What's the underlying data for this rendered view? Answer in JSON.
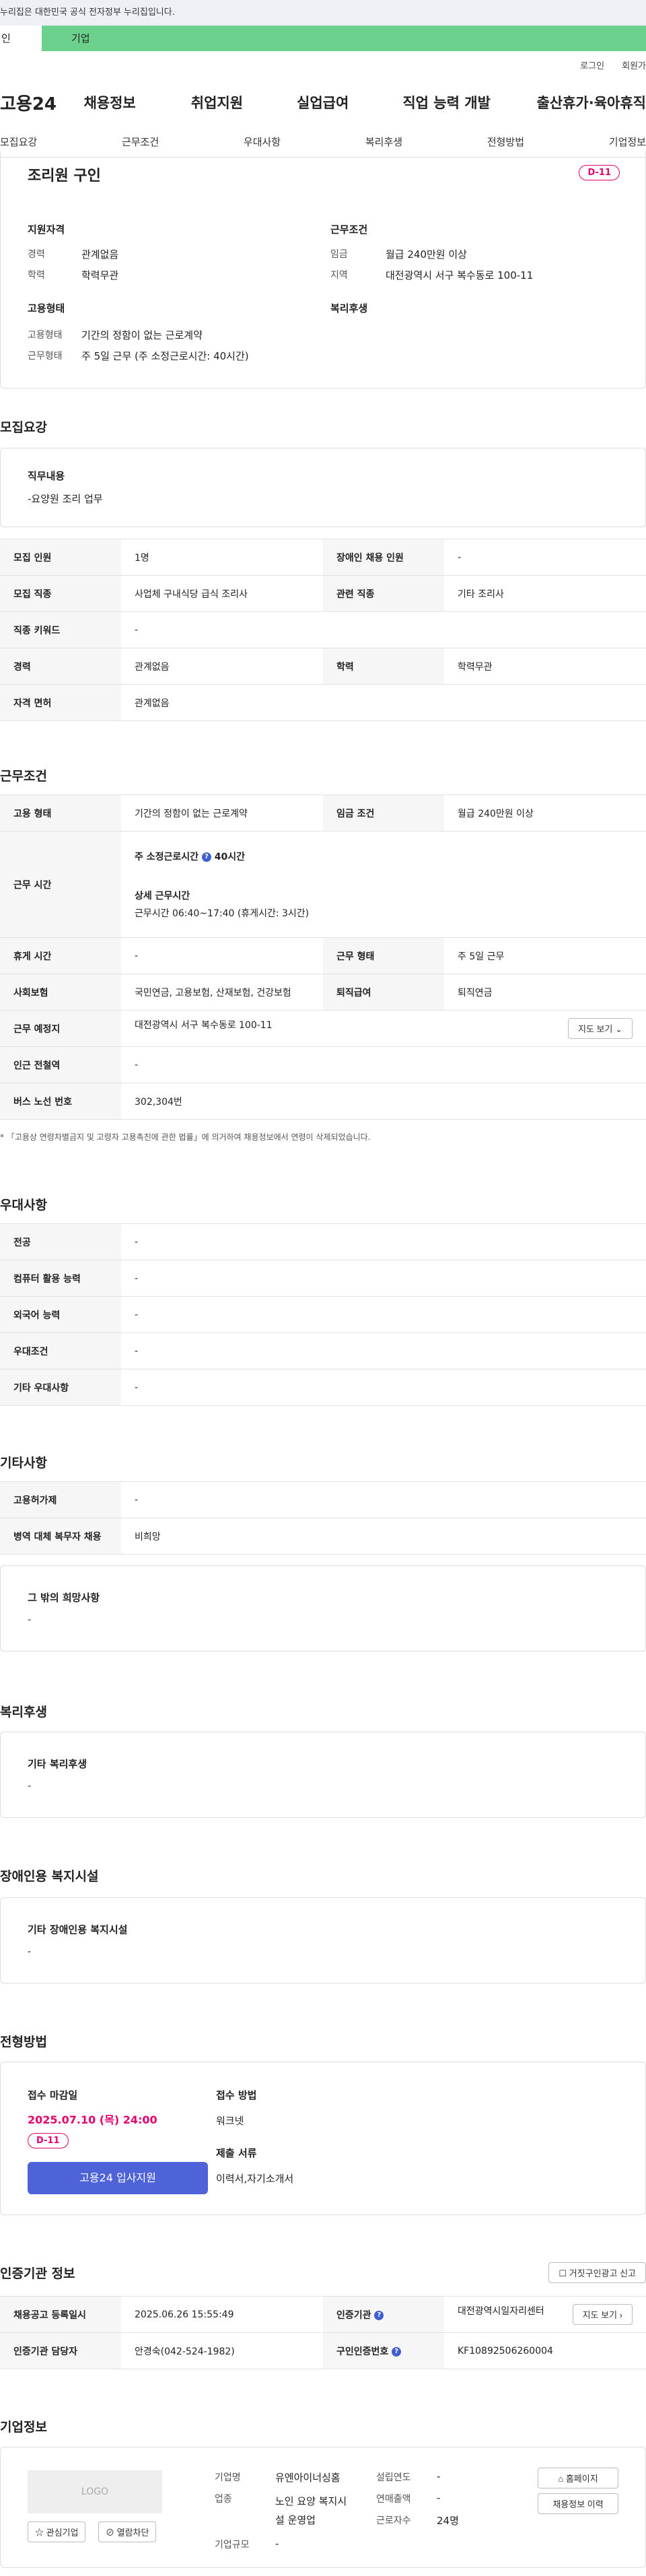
{
  "gov_bar": "누리집은 대한민국 공식 전자정부 누리집입니다.",
  "tabs": {
    "person": "인",
    "company": "기업"
  },
  "util": {
    "login": "로그인",
    "join": "회원가"
  },
  "gnb": {
    "logo": "고용24",
    "items": [
      "채용정보",
      "취업지원",
      "실업급여",
      "직업 능력 개발",
      "출산휴가·육아휴직"
    ]
  },
  "subnav": [
    "모집요강",
    "근무조건",
    "우대사항",
    "복리후생",
    "전형방법",
    "기업정보"
  ],
  "summary": {
    "title": "조리원 구인",
    "dday": "D-11",
    "qual_title": "지원자격",
    "career_label": "경력",
    "career_value": "관계없음",
    "edu_label": "학력",
    "edu_value": "학력무관",
    "cond_title": "근무조건",
    "wage_label": "임금",
    "wage_value": "월급 240만원 이상",
    "area_label": "지역",
    "area_value": "대전광역시 서구 복수동로 100-11",
    "emp_title": "고용형태",
    "emp_type_label": "고용형태",
    "emp_type_value": "기간의 정함이 없는 근로계약",
    "work_type_label": "근무형태",
    "work_type_value": "주 5일 근무 (주 소정근로시간: 40시간)",
    "welfare_title": "복리후생"
  },
  "recruit": {
    "title": "모집요강",
    "duty_label": "직무내용",
    "duty_value": "-요양원 조리 업무",
    "rows": {
      "headcount_label": "모집 인원",
      "headcount_value": "1명",
      "disabled_label": "장애인 채용 인원",
      "disabled_value": "-",
      "job_label": "모집 직종",
      "job_value": "사업체 구내식당 급식 조리사",
      "related_label": "관련 직종",
      "related_value": "기타 조리사",
      "keyword_label": "직종 키워드",
      "keyword_value": "-",
      "career_label": "경력",
      "career_value": "관계없음",
      "edu_label": "학력",
      "edu_value": "학력무관",
      "license_label": "자격 면허",
      "license_value": "관계없음"
    }
  },
  "work": {
    "title": "근무조건",
    "emp_label": "고용 형태",
    "emp_value": "기간의 정함이 없는 근로계약",
    "wage_label": "임금 조건",
    "wage_value": "월급 240만원 이상",
    "hours_label": "근무 시간",
    "hours_weekly_label": "주 소정근로시간",
    "hours_weekly_value": "40시간",
    "hours_detail_label": "상세 근무시간",
    "hours_detail_value": "근무시간 06:40~17:40 (휴게시간: 3시간)",
    "holiday_label": "휴게 시간",
    "holiday_value": "-",
    "form_label": "근무 형태",
    "form_value": "주 5일 근무",
    "insurance_label": "사회보험",
    "insurance_value": "국민연금, 고용보험, 산재보험, 건강보험",
    "retire_label": "퇴직급여",
    "retire_value": "퇴직연금",
    "place_label": "근무 예정지",
    "place_value": "대전광역시 서구 복수동로 100-11",
    "map_btn": "지도 보기",
    "subway_label": "인근 전철역",
    "subway_value": "-",
    "bus_label": "버스 노선 번호",
    "bus_value": "302,304번",
    "notice": "* 「고용상 연령차별금지 및 고령자 고용촉진에 관한 법률」에 의거하여 채용정보에서 연령이 삭제되었습니다."
  },
  "preference": {
    "title": "우대사항",
    "rows": [
      {
        "label": "전공",
        "value": "-"
      },
      {
        "label": "컴퓨터 활용 능력",
        "value": "-"
      },
      {
        "label": "외국어 능력",
        "value": "-"
      },
      {
        "label": "우대조건",
        "value": "-"
      },
      {
        "label": "기타 우대사항",
        "value": "-"
      }
    ]
  },
  "etc": {
    "title": "기타사항",
    "rows": [
      {
        "label": "고용허가제",
        "value": "-"
      },
      {
        "label": "병역 대체 복무자 채용",
        "value": "비희망"
      }
    ],
    "other_label": "그 밖의 희망사항",
    "other_value": "-"
  },
  "welfare": {
    "title": "복리후생",
    "label": "기타 복리후생",
    "value": "-"
  },
  "facility": {
    "title": "장애인용 복지시설",
    "label": "기타 장애인용 복지시설",
    "value": "-"
  },
  "screening": {
    "title": "전형방법",
    "deadline_label": "접수 마감일",
    "deadline_value": "2025.07.10 (목) 24:00",
    "dday": "D-11",
    "apply_btn": "고용24 입사지원",
    "method_label": "접수 방법",
    "method_value": "워크넷",
    "docs_label": "제출 서류",
    "docs_value": "이력서,자기소개서"
  },
  "auth": {
    "title": "인증기관 정보",
    "report_btn": "거짓구인광고 신고",
    "reg_label": "채용공고 등록일시",
    "reg_value": "2025.06.26 15:55:49",
    "org_label": "인증기관",
    "org_value": "대전광역시일자리센터",
    "map_btn": "지도 보기",
    "manager_label": "인증기관 담당자",
    "manager_value": "안경숙(042-524-1982)",
    "number_label": "구인인증번호",
    "number_value": "KF10892506260004"
  },
  "company": {
    "title": "기업정보",
    "logo_text": "LOGO",
    "fav_btn": "관심기업",
    "block_btn": "열람차단",
    "name_label": "기업명",
    "name_value": "유엔아이너싱홈",
    "biz_label": "업종",
    "biz_value": "노인 요양 복지시설 운영업",
    "size_label": "기업규모",
    "size_value": "-",
    "founded_label": "설립연도",
    "founded_value": "-",
    "sales_label": "연매출액",
    "sales_value": "-",
    "staff_label": "근로자수",
    "staff_value": "24명",
    "homepage_btn": "홈페이지",
    "history_btn": "채용정보 이력"
  }
}
